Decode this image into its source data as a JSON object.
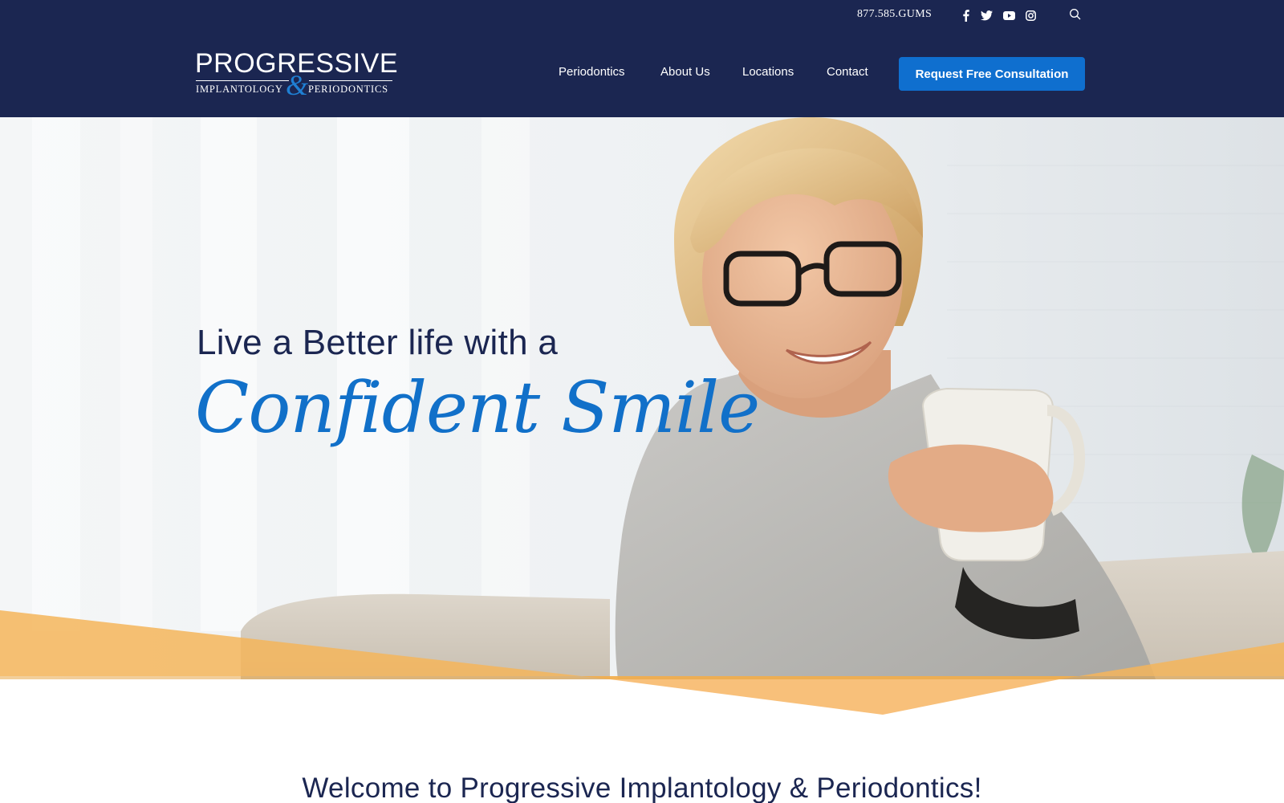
{
  "topbar": {
    "phone": "877.585.GUMS",
    "social_icons": [
      "facebook-icon",
      "twitter-icon",
      "youtube-icon",
      "instagram-icon"
    ],
    "search_icon": "search-icon"
  },
  "logo": {
    "name": "PROGRESSIVE",
    "left": "IMPLANTOLOGY",
    "amp": "&",
    "right": "PERIODONTICS"
  },
  "nav": {
    "items": [
      "Periodontics",
      "About Us",
      "Locations",
      "Contact"
    ],
    "cta": "Request Free Consultation"
  },
  "hero": {
    "line1": "Live a Better life with a",
    "line2": "Confident Smile"
  },
  "welcome": {
    "title": "Welcome to Progressive Implantology & Periodontics!"
  },
  "colors": {
    "navy": "#1b2651",
    "brand_blue": "#1170c9",
    "cta_blue": "#0f6fcf",
    "accent_orange": "#f4b55a"
  }
}
